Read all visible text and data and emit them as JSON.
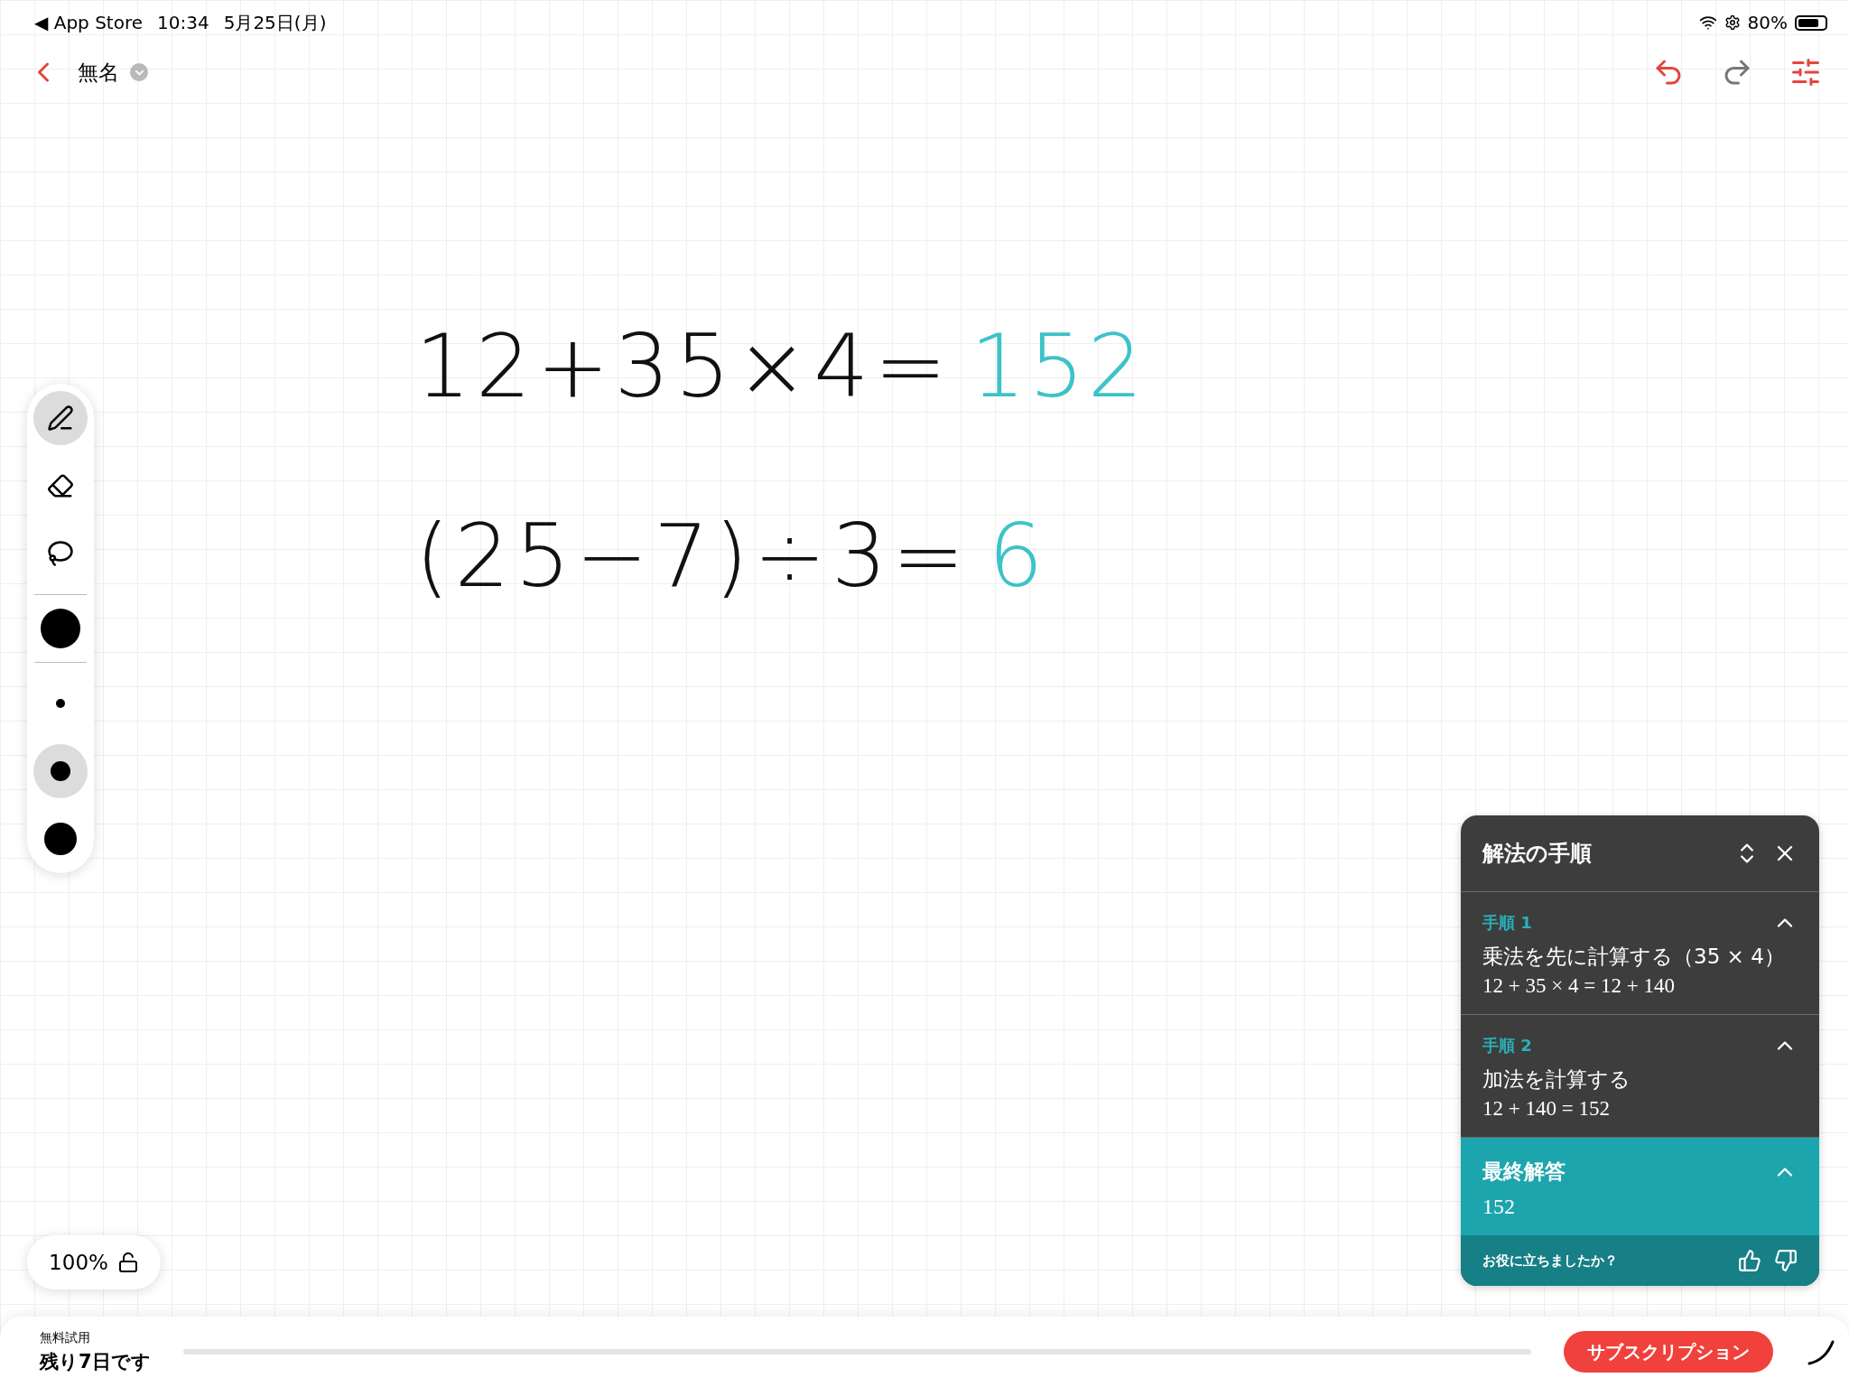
{
  "status_bar": {
    "back_link": "◀ App Store",
    "time": "10:34",
    "date": "5月25日(月)",
    "battery": "80%"
  },
  "header": {
    "title": "無名"
  },
  "tools": [
    {
      "kind": "pen",
      "selected": true
    },
    {
      "kind": "eraser",
      "selected": false
    },
    {
      "kind": "lasso",
      "selected": false
    }
  ],
  "ink": {
    "color": "#000000"
  },
  "sizes": [
    {
      "kind": "small",
      "selected": false
    },
    {
      "kind": "medium",
      "selected": true
    },
    {
      "kind": "large",
      "selected": false
    }
  ],
  "canvas": {
    "lines": [
      {
        "expression": "12+35×4=",
        "answer": "152"
      },
      {
        "expression": "(25−7)÷3=",
        "answer": "6"
      }
    ]
  },
  "steps_panel": {
    "title": "解法の手順",
    "steps": [
      {
        "label": "手順 1",
        "description": "乗法を先に計算する（35 × 4）",
        "equation": "12 + 35 × 4 = 12 + 140",
        "expanded": true
      },
      {
        "label": "手順 2",
        "description": "加法を計算する",
        "equation": "12 + 140 = 152",
        "expanded": true
      }
    ],
    "final": {
      "label": "最終解答",
      "value": "152",
      "expanded": true
    },
    "feedback": "お役に立ちましたか？"
  },
  "zoom": {
    "level_text": "100%",
    "locked": false
  },
  "trial": {
    "label": "無料試用",
    "remaining": "残り7日です",
    "button": "サブスクリプション"
  }
}
